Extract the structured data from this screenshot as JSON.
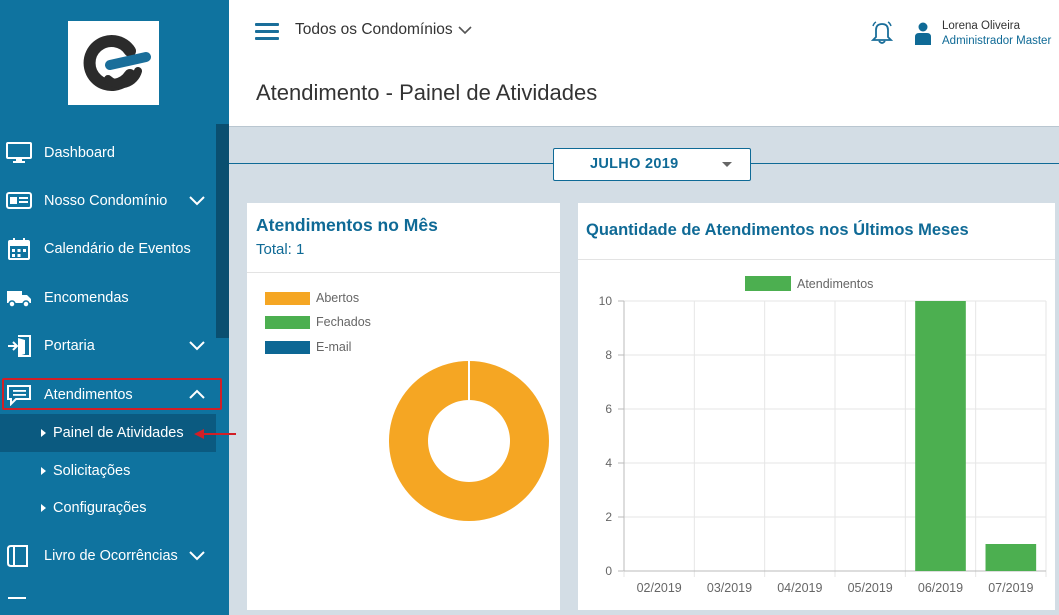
{
  "sidebar": {
    "items": [
      {
        "label": "Dashboard"
      },
      {
        "label": "Nosso Condomínio"
      },
      {
        "label": "Calendário de Eventos"
      },
      {
        "label": "Encomendas"
      },
      {
        "label": "Portaria"
      },
      {
        "label": "Atendimentos"
      },
      {
        "label": "Livro de Ocorrências"
      }
    ],
    "subitems": [
      {
        "label": "Painel de Atividades"
      },
      {
        "label": "Solicitações"
      },
      {
        "label": "Configurações"
      }
    ]
  },
  "header": {
    "condo_selector": "Todos os Condomínios",
    "user_name": "Lorena Oliveira",
    "user_role": "Administrador Master"
  },
  "page": {
    "title": "Atendimento - Painel de Atividades",
    "month_selector": "JULHO 2019"
  },
  "card_month": {
    "title": "Atendimentos no Mês",
    "total_label": "Total:",
    "total_value": "1",
    "legend": [
      {
        "label": "Abertos",
        "color": "#f5a623"
      },
      {
        "label": "Fechados",
        "color": "#4caf50"
      },
      {
        "label": "E-mail",
        "color": "#0d6794"
      }
    ]
  },
  "card_months": {
    "title": "Quantidade de Atendimentos nos Últimos Meses"
  },
  "chart_data": [
    {
      "type": "pie",
      "categories": [
        "Abertos",
        "Fechados",
        "E-mail"
      ],
      "values": [
        1,
        0,
        0
      ],
      "colors": [
        "#f5a623",
        "#4caf50",
        "#0d6794"
      ],
      "donut": true,
      "legend": "top-left"
    },
    {
      "type": "bar",
      "categories": [
        "02/2019",
        "03/2019",
        "04/2019",
        "05/2019",
        "06/2019",
        "07/2019"
      ],
      "series": [
        {
          "name": "Atendimentos",
          "values": [
            0,
            0,
            0,
            0,
            10,
            1
          ],
          "color": "#4caf50"
        }
      ],
      "ylim": [
        0,
        10
      ],
      "yticks": [
        0,
        2,
        4,
        6,
        8,
        10
      ],
      "grid": true,
      "legend": "top-center"
    }
  ]
}
